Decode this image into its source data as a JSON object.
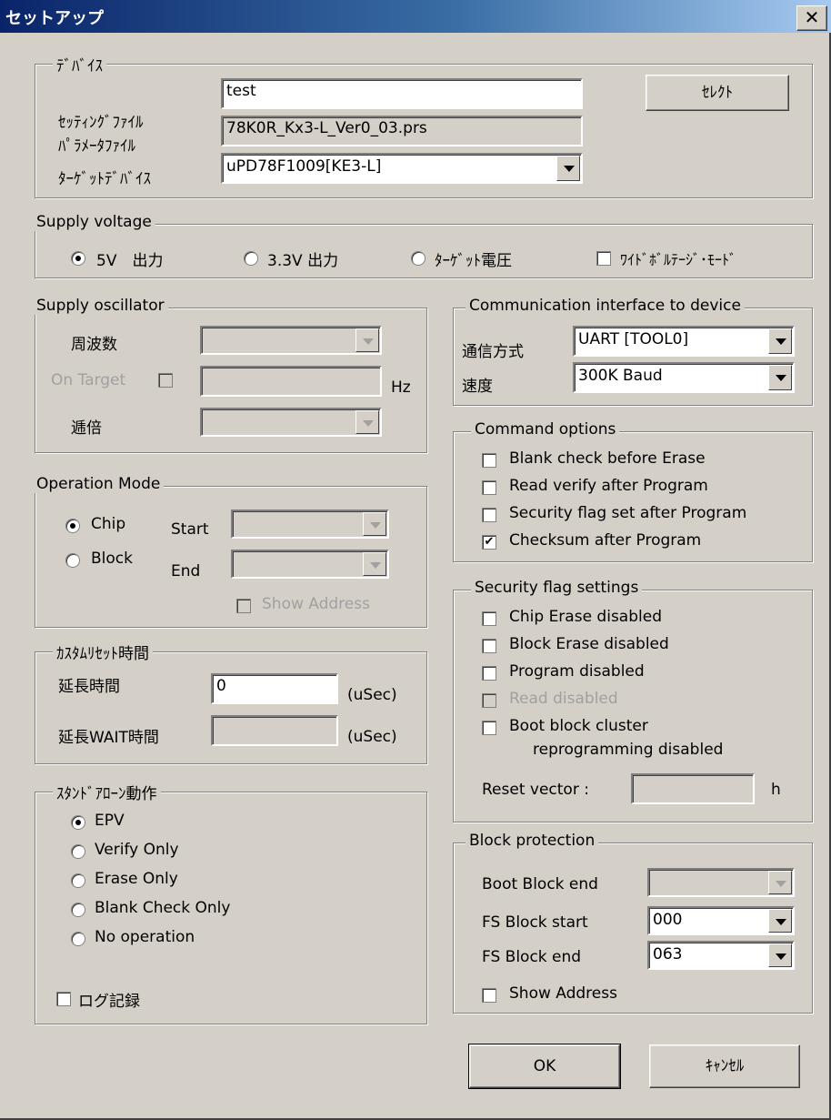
{
  "window": {
    "title": "セットアップ",
    "close_glyph": "✕"
  },
  "device": {
    "group_label": "ﾃﾞﾊﾞｲｽ",
    "setting_file_label": "ｾｯﾃｨﾝｸﾞﾌｧｲﾙ",
    "setting_file_value": "test",
    "select_button": "ｾﾚｸﾄ",
    "parameter_file_label": "ﾊﾟﾗﾒｰﾀﾌｧｲﾙ",
    "parameter_file_value": "78K0R_Kx3-L_Ver0_03.prs",
    "target_device_label": "ﾀｰｹﾞｯﾄﾃﾞﾊﾞｲｽ",
    "target_device_value": "uPD78F1009[KE3-L]"
  },
  "supply_voltage": {
    "group_label": "Supply voltage",
    "opt_5v": "5V　出力",
    "opt_33v": "3.3V 出力",
    "opt_target": "ﾀｰｹﾞｯﾄ電圧",
    "wide_voltage": "ﾜｲﾄﾞﾎﾞﾙﾃｰｼﾞ･ﾓｰﾄﾞ",
    "selected": "5V"
  },
  "supply_osc": {
    "group_label": "Supply oscillator",
    "frequency_label": "周波数",
    "on_target_label": "On Target",
    "hz_label": "Hz",
    "multiplier_label": "逓倍"
  },
  "operation_mode": {
    "group_label": "Operation Mode",
    "chip": "Chip",
    "block": "Block",
    "start": "Start",
    "end": "End",
    "show_address": "Show Address",
    "selected": "Chip"
  },
  "custom_reset": {
    "group_label": "ｶｽﾀﾑﾘｾｯﾄ時間",
    "extend_label": "延長時間",
    "extend_value": "0",
    "extend_unit": "(uSec)",
    "wait_label": "延長WAIT時間",
    "wait_unit": "(uSec)"
  },
  "standalone": {
    "group_label": "ｽﾀﾝﾄﾞｱﾛｰﾝ動作",
    "epv": "EPV",
    "verify": "Verify Only",
    "erase": "Erase Only",
    "blank": "Blank Check Only",
    "noop": "No operation",
    "log": "ログ記録",
    "selected": "EPV"
  },
  "comm": {
    "group_label": "Communication interface to device",
    "method_label": "通信方式",
    "method_value": "UART [TOOL0]",
    "speed_label": "速度",
    "speed_value": "300K Baud"
  },
  "command_options": {
    "group_label": "Command options",
    "items": [
      {
        "label": "Blank check before Erase",
        "checked": false
      },
      {
        "label": "Read verify after Program",
        "checked": false
      },
      {
        "label": "Security flag set after Program",
        "checked": false
      },
      {
        "label": "Checksum after Program",
        "checked": true
      }
    ]
  },
  "security": {
    "group_label": "Security flag settings",
    "chip_erase": "Chip Erase disabled",
    "block_erase": "Block Erase disabled",
    "program": "Program disabled",
    "read": "Read disabled",
    "boot_line1": "Boot block cluster",
    "boot_line2": "reprogramming disabled",
    "reset_vector_label": "Reset vector :",
    "reset_vector_unit": "h"
  },
  "block_protection": {
    "group_label": "Block protection",
    "boot_block_end_label": "Boot Block end",
    "fs_start_label": "FS Block start",
    "fs_start_value": "000",
    "fs_end_label": "FS Block end",
    "fs_end_value": "063",
    "show_address": "Show Address"
  },
  "buttons": {
    "ok": "OK",
    "cancel": "ｷｬﾝｾﾙ"
  }
}
